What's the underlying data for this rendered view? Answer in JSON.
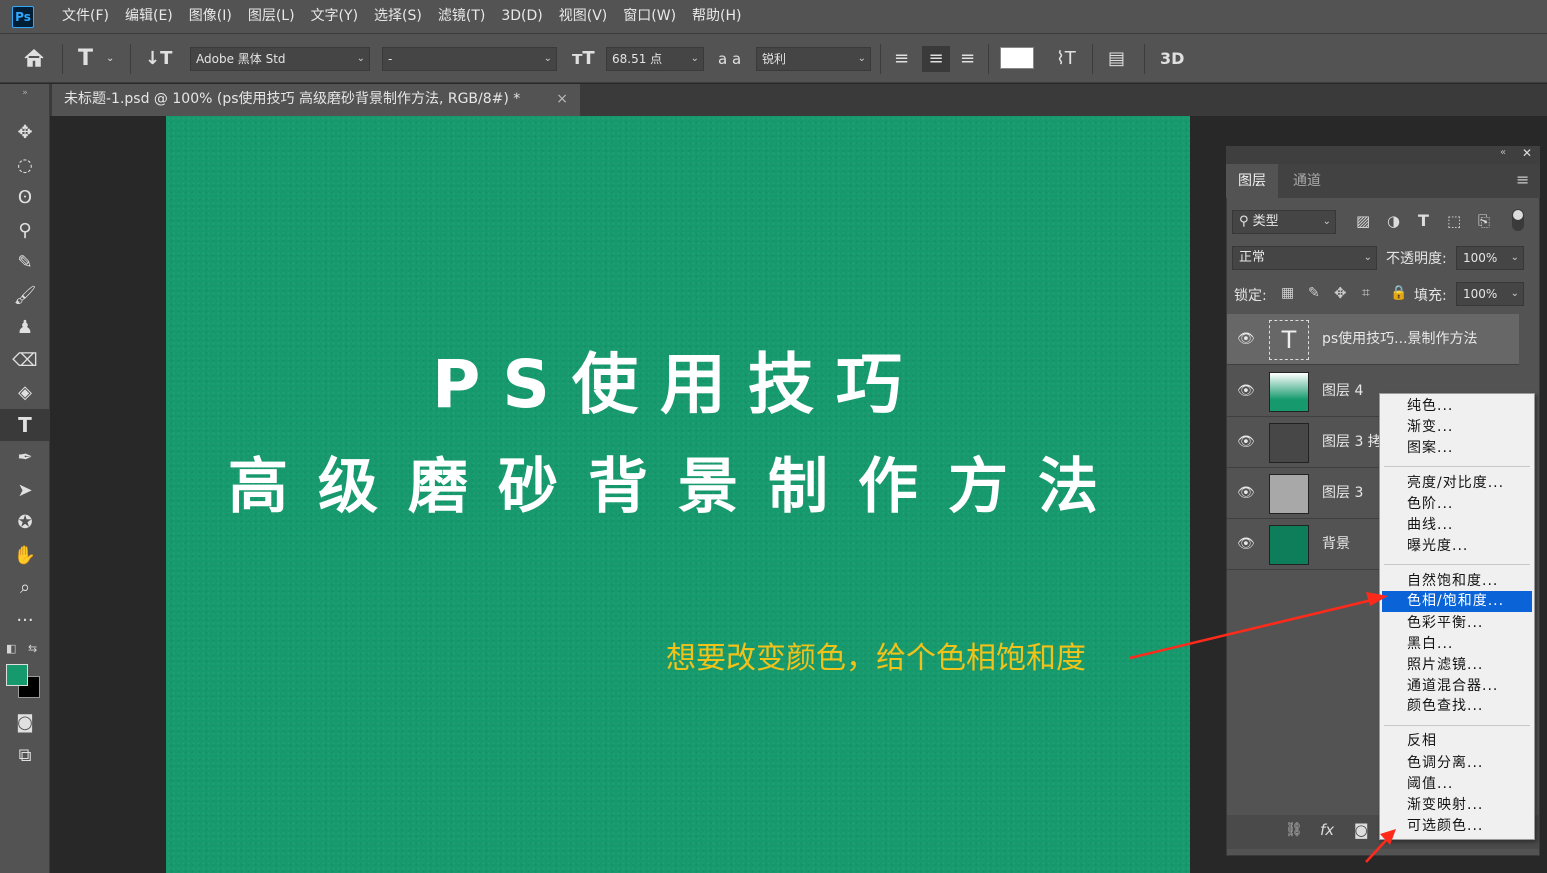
{
  "menubar": {
    "logo": "Ps",
    "items": [
      "文件(F)",
      "编辑(E)",
      "图像(I)",
      "图层(L)",
      "文字(Y)",
      "选择(S)",
      "滤镜(T)",
      "3D(D)",
      "视图(V)",
      "窗口(W)",
      "帮助(H)"
    ]
  },
  "options": {
    "font_family": "Adobe 黑体 Std",
    "font_style": "-",
    "font_size": "68.51 点",
    "antialias_icon": "a a",
    "antialias": "锐利",
    "three_d": "3D"
  },
  "tab": {
    "title": "未标题-1.psd @ 100% (ps使用技巧 高级磨砂背景制作方法, RGB/8#) *",
    "close": "×"
  },
  "canvas": {
    "line1": "PS使用技巧",
    "line2": "高级磨砂背景制作方法",
    "annotation": "想要改变颜色，给个色相饱和度",
    "bg_color": "#169a6d",
    "annotation_color": "#f0c21a"
  },
  "layers_panel": {
    "tabs": [
      "图层",
      "通道"
    ],
    "filter_label": "类型",
    "blend_mode": "正常",
    "opacity_label": "不透明度:",
    "opacity": "100%",
    "lock_label": "锁定:",
    "fill_label": "填充:",
    "fill": "100%",
    "layers": [
      {
        "name": "ps使用技巧...景制作方法",
        "kind": "text",
        "selected": true
      },
      {
        "name": "图层 4",
        "kind": "gradient",
        "selected": false
      },
      {
        "name": "图层 3 拷",
        "kind": "dark-noise",
        "selected": false
      },
      {
        "name": "图层 3",
        "kind": "light-noise",
        "selected": false
      },
      {
        "name": "背景",
        "kind": "solid",
        "selected": false
      }
    ],
    "fx_label": "fx"
  },
  "context_menu": {
    "groups": [
      [
        "纯色...",
        "渐变...",
        "图案..."
      ],
      [
        "亮度/对比度...",
        "色阶...",
        "曲线...",
        "曝光度..."
      ],
      [
        "自然饱和度...",
        "色相/饱和度...",
        "色彩平衡...",
        "黑白...",
        "照片滤镜...",
        "通道混合器...",
        "颜色查找..."
      ],
      [
        "反相",
        "色调分离...",
        "阈值...",
        "渐变映射...",
        "可选颜色..."
      ]
    ],
    "highlighted": "色相/饱和度..."
  }
}
